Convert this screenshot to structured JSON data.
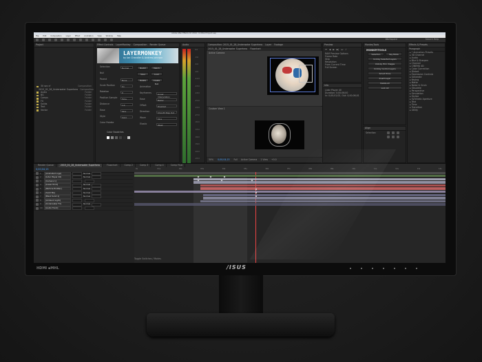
{
  "app": {
    "window_title": "Adobe After Effects CC 2014 - Untitled Project.aep",
    "menu": [
      "File",
      "Edit",
      "Composition",
      "Layer",
      "Effect",
      "Animation",
      "View",
      "Window",
      "Help"
    ],
    "workspace": "Workspace",
    "search_help": "Search Help"
  },
  "project_panel": {
    "tab": "Project",
    "items": [
      {
        "name": "30 sec cf",
        "type": "Composition"
      },
      {
        "name": "2015_01_28_Underwater Superhero",
        "type": "Composition"
      },
      {
        "name": "Audio",
        "type": "Folder"
      },
      {
        "name": "BG",
        "type": "Folder"
      },
      {
        "name": "Comps",
        "type": "Folder"
      },
      {
        "name": "FX",
        "type": "Folder"
      },
      {
        "name": "Solids",
        "type": "Folder"
      },
      {
        "name": "Text",
        "type": "Folder"
      },
      {
        "name": "Vector",
        "type": "Folder"
      }
    ]
  },
  "effect_controls": {
    "tabs": [
      "Effect Controls",
      "LayerMonkey",
      "Composition",
      "Render Queue"
    ],
    "banner_logo": "LAYERMONKEY",
    "banner_sub": "by Ian Chandler & Andrew Johnson",
    "rows": [
      {
        "label": "Selection",
        "value": "Normal"
      },
      {
        "label": "Null",
        "value": ""
      },
      {
        "label": "Parent",
        "value": "None"
      },
      {
        "label": "Scale Position",
        "value": "On"
      },
      {
        "label": "Rotation",
        "value": "0"
      },
      {
        "label": "Position Sample",
        "value": "Time"
      },
      {
        "label": "Distance",
        "value": "1.0"
      },
      {
        "label": "Ease",
        "value": "Sine"
      },
      {
        "label": "Style",
        "value": "Solid"
      },
      {
        "label": "Color Palette",
        "value": ""
      }
    ],
    "buttons": [
      "Sketch",
      "Match",
      "Save",
      "Load",
      "Delete",
      "Create Null"
    ],
    "right_rows": [
      {
        "label": "Animation",
        "value": ""
      },
      {
        "label": "Keyframes",
        "value": "Linear Interpolation"
      },
      {
        "label": "Ease",
        "value": "Bezier"
      },
      {
        "label": "Offset",
        "value": "Disabled"
      },
      {
        "label": "Direction",
        "value": "Smooth Step Out"
      },
      {
        "label": "Wave",
        "value": "Sine"
      },
      {
        "label": "Elastic",
        "value": "Weak"
      }
    ],
    "color_label": "Color Swatches",
    "swatches": [
      "#ffffff",
      "#8a8a8a",
      "#5f5f5f",
      "#404040",
      "#2a2a2a",
      "#c9c9c9"
    ]
  },
  "audio_meter": {
    "tab": "Audio",
    "scale": [
      "0.0",
      "-3.0",
      "-6.0",
      "-9.0",
      "-12.0",
      "-15.0",
      "-18.0",
      "-21.0",
      "-24.0",
      "-27.0",
      "-30.0",
      "-33.0",
      "-36.0",
      "-39.0",
      "-42.0",
      "-45.0",
      "-48.0"
    ]
  },
  "composition": {
    "tabs": [
      "Composition: 2015_01_28_Underwater Superhero",
      "Layer",
      "Footage"
    ],
    "sub_tabs": [
      "2015_01_28_Underwater Superhero",
      "Flowchart"
    ],
    "view_label_top": "Active Camera",
    "view_label_bottom": "Custom View 1",
    "zoom": "50%",
    "time": "0;00;04;15",
    "footer_items": [
      "Full",
      "Active Camera",
      "1 View",
      "+0.0"
    ]
  },
  "preview": {
    "tab": "Preview",
    "rows": [
      "RAM Preview Options",
      "Frame Rate",
      "Skip",
      "Resolution",
      "From Current Time",
      "Full Screen"
    ]
  },
  "info": {
    "tab": "Info",
    "lines": [
      "Lidar Player 40",
      "Duration: 0;00;06;00",
      "In: 0;00;01;02, Out: 0;00;06;01"
    ]
  },
  "monkey_tools": {
    "tab": "MonkeyTools",
    "brand": "MONKEYTOOLS",
    "buttons": [
      "Selection",
      "Key Mode",
      "Unlinky Selected Layers",
      "Unlinky Trim Images",
      "Unlinky Control Layers",
      "Smart Trims",
      "Insert Layer",
      "Delete All",
      "Lock All"
    ]
  },
  "effects_presets": {
    "tab": "Effects & Presets",
    "items": [
      "* Animation Presets",
      "3D Channel",
      "Audio",
      "Blur & Sharpen",
      "Channel",
      "CINEMA 4D",
      "Color Correction",
      "Distort",
      "Expression Controls",
      "Generate",
      "Keying",
      "Matte",
      "Noise & Grain",
      "Obsolete",
      "Perspective",
      "Simulation",
      "Stylize",
      "Synthetic Aperture",
      "Text",
      "Time",
      "Transition",
      "Utility"
    ]
  },
  "align": {
    "tab": "Align",
    "paragraph_tab": "Paragraph",
    "align_to": "Selection"
  },
  "timeline": {
    "tabs": [
      "Render Queue",
      "2015_01_28_Underwater Superhero",
      "Flowchart",
      "Comp 2",
      "Comp 3",
      "Comp 4",
      "Comp Final"
    ],
    "timecode": "0;00;04;15",
    "layers": [
      {
        "num": "1",
        "name": "[Animated Logo]",
        "mode": "Normal"
      },
      {
        "num": "2",
        "name": "[Lidar Player 40]",
        "mode": "Normal"
      },
      {
        "num": "3",
        "name": "[Camera 1]",
        "mode": ""
      },
      {
        "num": "4",
        "name": "[Lower third]",
        "mode": "Normal"
      },
      {
        "num": "5",
        "name": "[Particle Emitter]",
        "mode": "Normal"
      },
      {
        "num": "6",
        "name": "[Solid BG]",
        "mode": "Normal"
      },
      {
        "num": "7",
        "name": "[Black Solid 1]",
        "mode": "Normal"
      },
      {
        "num": "8",
        "name": "[Ambient Light]",
        "mode": ""
      },
      {
        "num": "9",
        "name": "[Underwater FX]",
        "mode": "Normal"
      },
      {
        "num": "10",
        "name": "[Audio Track]",
        "mode": ""
      }
    ],
    "ruler": [
      "0s",
      "01s",
      "02s",
      "03s",
      "04s",
      "05s",
      "06s",
      "07s",
      "08s",
      "09s",
      "10s",
      "11s",
      "12s",
      "13s",
      "14s"
    ],
    "footer": "Toggle Switches / Modes",
    "track_colors": [
      "#5a7a4a",
      "#b5b5c8",
      "#a3a3b8",
      "#c05858",
      "#d76a6a",
      "#9a8fb0",
      "#6e6e8c",
      "#9090a8",
      "#7a7a92",
      "#55556a"
    ]
  },
  "monitor": {
    "brand": "/ISUS",
    "ports": "HDMI ▪MHL"
  },
  "colors": {
    "accent_blue": "#4aa3ff",
    "playhead_red": "#e44444",
    "meter_green": "#5ca33b"
  }
}
